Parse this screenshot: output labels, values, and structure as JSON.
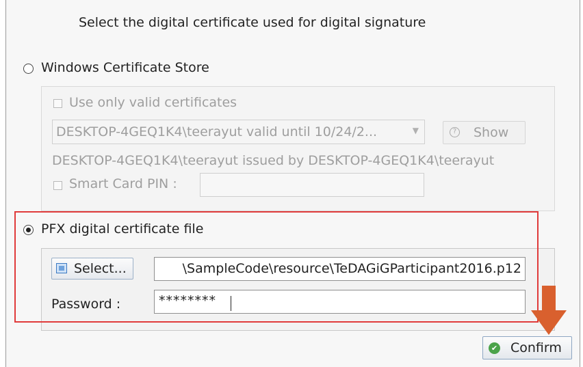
{
  "dialog": {
    "title": "Select the digital certificate used for digital signature"
  },
  "windows_store": {
    "radio_label": "Windows Certificate Store",
    "selected": false,
    "valid_only_label": "Use only valid certificates",
    "certificate_combo_value": "DESKTOP-4GEQ1K4\\teerayut valid until 10/24/2...",
    "show_button_label": "Show",
    "issued_text": "DESKTOP-4GEQ1K4\\teerayut issued by DESKTOP-4GEQ1K4\\teerayut",
    "smart_card_label": "Smart Card PIN :",
    "smart_card_value": ""
  },
  "pfx": {
    "radio_label": "PFX digital certificate file",
    "selected": true,
    "select_button_label": "Select...",
    "file_path_value": "\\SampleCode\\resource\\TeDAGiGParticipant2016.p12",
    "password_label": "Password :",
    "password_value": "********"
  },
  "footer": {
    "confirm_label": "Confirm"
  },
  "icons": {
    "show": "magnifier-icon",
    "select": "folder-icon",
    "confirm": "check-circle-icon"
  },
  "colors": {
    "highlight": "#e03a3a",
    "arrow": "#d9602e",
    "confirm_icon": "#4ba34a"
  }
}
